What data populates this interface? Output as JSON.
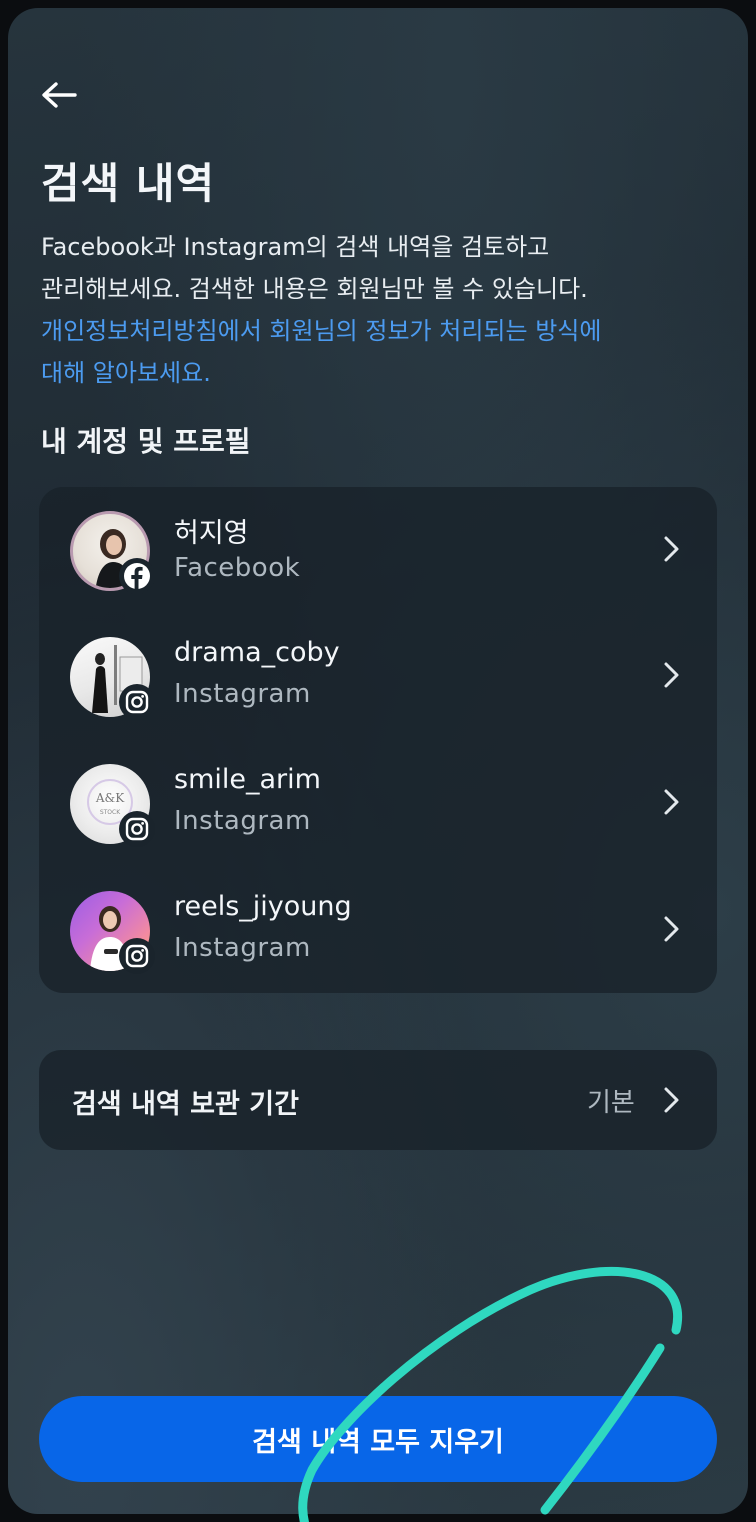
{
  "header": {
    "back_icon": "arrow-left-icon",
    "title": "검색 내역"
  },
  "description": {
    "line1": "Facebook과 Instagram의 검색 내역을 검토하고",
    "line2": "관리해보세요. 검색한 내용은 회원님만 볼 수 있습니다.",
    "link_line1": "개인정보처리방침에서 회원님의 정보가 처리되는 방식에",
    "link_line2": "대해 알아보세요.",
    "link_color": "#4c9bf0"
  },
  "accounts_section": {
    "title": "내 계정 및 프로필",
    "accounts": [
      {
        "name": "허지영",
        "platform": "Facebook",
        "badge_icon": "facebook-icon"
      },
      {
        "name": "drama_coby",
        "platform": "Instagram",
        "badge_icon": "instagram-icon"
      },
      {
        "name": "smile_arim",
        "platform": "Instagram",
        "badge_icon": "instagram-icon",
        "avatar_text_1": "A&K",
        "avatar_text_2": "STOCK"
      },
      {
        "name": "reels_jiyoung",
        "platform": "Instagram",
        "badge_icon": "instagram-icon"
      }
    ]
  },
  "retention": {
    "label": "검색 내역 보관 기간",
    "value": "기본"
  },
  "clear_button": {
    "label": "검색 내역 모두 지우기",
    "color": "#0866e8"
  },
  "annotation_color": "#2fd8c0"
}
